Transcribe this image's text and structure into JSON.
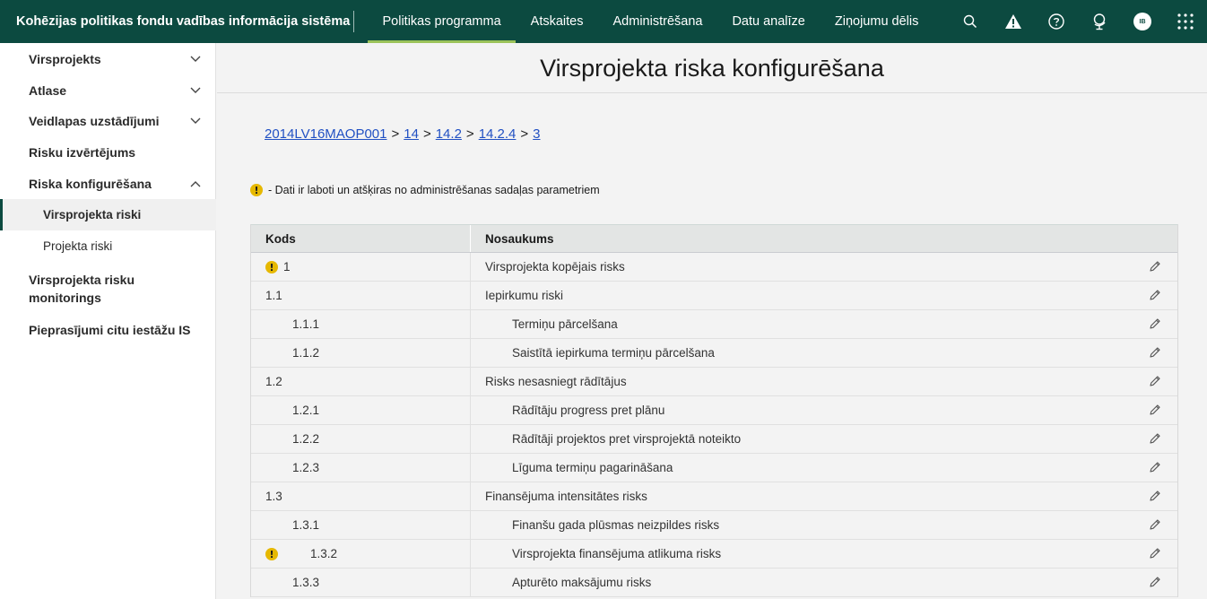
{
  "app": {
    "title": "Kohēzijas politikas fondu vadības informācija sistēma"
  },
  "topnav": [
    {
      "label": "Politikas programma",
      "active": true
    },
    {
      "label": "Atskaites"
    },
    {
      "label": "Administrēšana"
    },
    {
      "label": "Datu analīze"
    },
    {
      "label": "Ziņojumu dēlis"
    }
  ],
  "header_icons": {
    "search": "search-icon",
    "warning": "warning-icon",
    "help": "help-icon",
    "globe": "globe-icon",
    "avatar_initials": "IB",
    "apps": "apps-grid-icon"
  },
  "sidebar": {
    "items": [
      {
        "label": "Virsprojekts",
        "expandable": true
      },
      {
        "label": "Atlase",
        "expandable": true
      },
      {
        "label": "Veidlapas uzstādījumi",
        "expandable": true
      },
      {
        "label": "Risku izvērtējums"
      },
      {
        "label": "Riska konfigurēšana",
        "expanded": true
      },
      {
        "label": "Virsprojekta riski",
        "sub": true,
        "active": true
      },
      {
        "label": "Projekta riski",
        "sub": true
      },
      {
        "label": "Virsprojekta risku monitorings"
      },
      {
        "label": "Pieprasījumi citu iestāžu IS"
      }
    ]
  },
  "page": {
    "title": "Virsprojekta riska konfigurēšana",
    "breadcrumb": [
      "2014LV16MAOP001",
      "14",
      "14.2",
      "14.2.4",
      "3"
    ],
    "breadcrumb_separator": ">",
    "notice": "- Dati ir laboti un atšķiras no administrēšanas sadaļas parametriem",
    "warning_glyph": "!"
  },
  "table": {
    "columns": [
      "Kods",
      "Nosaukums"
    ],
    "rows": [
      {
        "code": "1",
        "name": "Virsprojekta kopējais risks",
        "level": 0,
        "warn": true
      },
      {
        "code": "1.1",
        "name": "Iepirkumu riski",
        "level": 0
      },
      {
        "code": "1.1.1",
        "name": "Termiņu pārcelšana",
        "level": 1
      },
      {
        "code": "1.1.2",
        "name": "Saistītā iepirkuma termiņu pārcelšana",
        "level": 1
      },
      {
        "code": "1.2",
        "name": "Risks nesasniegt rādītājus",
        "level": 0
      },
      {
        "code": "1.2.1",
        "name": "Rādītāju progress pret plānu",
        "level": 1
      },
      {
        "code": "1.2.2",
        "name": "Rādītāji projektos pret virsprojektā noteikto",
        "level": 1
      },
      {
        "code": "1.2.3",
        "name": "Līguma termiņu pagarināšana",
        "level": 1
      },
      {
        "code": "1.3",
        "name": "Finansējuma intensitātes risks",
        "level": 0
      },
      {
        "code": "1.3.1",
        "name": "Finanšu gada plūsmas neizpildes risks",
        "level": 1
      },
      {
        "code": "1.3.2",
        "name": "Virsprojekta finansējuma atlikuma risks",
        "level": 1,
        "warn": true
      },
      {
        "code": "1.3.3",
        "name": "Apturēto maksājumu risks",
        "level": 1
      }
    ]
  },
  "colors": {
    "topbar": "#0c4a40",
    "active_underline": "#9bc35a",
    "link": "#2150c3",
    "warning": "#e6b800"
  }
}
